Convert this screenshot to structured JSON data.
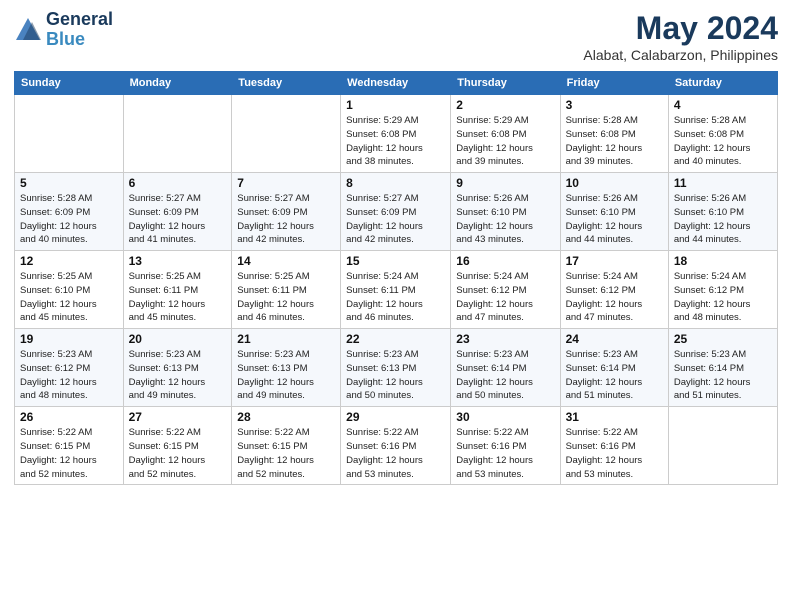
{
  "logo": {
    "line1": "General",
    "line2": "Blue"
  },
  "header": {
    "month_year": "May 2024",
    "location": "Alabat, Calabarzon, Philippines"
  },
  "days_of_week": [
    "Sunday",
    "Monday",
    "Tuesday",
    "Wednesday",
    "Thursday",
    "Friday",
    "Saturday"
  ],
  "weeks": [
    [
      {
        "day": "",
        "info": ""
      },
      {
        "day": "",
        "info": ""
      },
      {
        "day": "",
        "info": ""
      },
      {
        "day": "1",
        "info": "Sunrise: 5:29 AM\nSunset: 6:08 PM\nDaylight: 12 hours\nand 38 minutes."
      },
      {
        "day": "2",
        "info": "Sunrise: 5:29 AM\nSunset: 6:08 PM\nDaylight: 12 hours\nand 39 minutes."
      },
      {
        "day": "3",
        "info": "Sunrise: 5:28 AM\nSunset: 6:08 PM\nDaylight: 12 hours\nand 39 minutes."
      },
      {
        "day": "4",
        "info": "Sunrise: 5:28 AM\nSunset: 6:08 PM\nDaylight: 12 hours\nand 40 minutes."
      }
    ],
    [
      {
        "day": "5",
        "info": "Sunrise: 5:28 AM\nSunset: 6:09 PM\nDaylight: 12 hours\nand 40 minutes."
      },
      {
        "day": "6",
        "info": "Sunrise: 5:27 AM\nSunset: 6:09 PM\nDaylight: 12 hours\nand 41 minutes."
      },
      {
        "day": "7",
        "info": "Sunrise: 5:27 AM\nSunset: 6:09 PM\nDaylight: 12 hours\nand 42 minutes."
      },
      {
        "day": "8",
        "info": "Sunrise: 5:27 AM\nSunset: 6:09 PM\nDaylight: 12 hours\nand 42 minutes."
      },
      {
        "day": "9",
        "info": "Sunrise: 5:26 AM\nSunset: 6:10 PM\nDaylight: 12 hours\nand 43 minutes."
      },
      {
        "day": "10",
        "info": "Sunrise: 5:26 AM\nSunset: 6:10 PM\nDaylight: 12 hours\nand 44 minutes."
      },
      {
        "day": "11",
        "info": "Sunrise: 5:26 AM\nSunset: 6:10 PM\nDaylight: 12 hours\nand 44 minutes."
      }
    ],
    [
      {
        "day": "12",
        "info": "Sunrise: 5:25 AM\nSunset: 6:10 PM\nDaylight: 12 hours\nand 45 minutes."
      },
      {
        "day": "13",
        "info": "Sunrise: 5:25 AM\nSunset: 6:11 PM\nDaylight: 12 hours\nand 45 minutes."
      },
      {
        "day": "14",
        "info": "Sunrise: 5:25 AM\nSunset: 6:11 PM\nDaylight: 12 hours\nand 46 minutes."
      },
      {
        "day": "15",
        "info": "Sunrise: 5:24 AM\nSunset: 6:11 PM\nDaylight: 12 hours\nand 46 minutes."
      },
      {
        "day": "16",
        "info": "Sunrise: 5:24 AM\nSunset: 6:12 PM\nDaylight: 12 hours\nand 47 minutes."
      },
      {
        "day": "17",
        "info": "Sunrise: 5:24 AM\nSunset: 6:12 PM\nDaylight: 12 hours\nand 47 minutes."
      },
      {
        "day": "18",
        "info": "Sunrise: 5:24 AM\nSunset: 6:12 PM\nDaylight: 12 hours\nand 48 minutes."
      }
    ],
    [
      {
        "day": "19",
        "info": "Sunrise: 5:23 AM\nSunset: 6:12 PM\nDaylight: 12 hours\nand 48 minutes."
      },
      {
        "day": "20",
        "info": "Sunrise: 5:23 AM\nSunset: 6:13 PM\nDaylight: 12 hours\nand 49 minutes."
      },
      {
        "day": "21",
        "info": "Sunrise: 5:23 AM\nSunset: 6:13 PM\nDaylight: 12 hours\nand 49 minutes."
      },
      {
        "day": "22",
        "info": "Sunrise: 5:23 AM\nSunset: 6:13 PM\nDaylight: 12 hours\nand 50 minutes."
      },
      {
        "day": "23",
        "info": "Sunrise: 5:23 AM\nSunset: 6:14 PM\nDaylight: 12 hours\nand 50 minutes."
      },
      {
        "day": "24",
        "info": "Sunrise: 5:23 AM\nSunset: 6:14 PM\nDaylight: 12 hours\nand 51 minutes."
      },
      {
        "day": "25",
        "info": "Sunrise: 5:23 AM\nSunset: 6:14 PM\nDaylight: 12 hours\nand 51 minutes."
      }
    ],
    [
      {
        "day": "26",
        "info": "Sunrise: 5:22 AM\nSunset: 6:15 PM\nDaylight: 12 hours\nand 52 minutes."
      },
      {
        "day": "27",
        "info": "Sunrise: 5:22 AM\nSunset: 6:15 PM\nDaylight: 12 hours\nand 52 minutes."
      },
      {
        "day": "28",
        "info": "Sunrise: 5:22 AM\nSunset: 6:15 PM\nDaylight: 12 hours\nand 52 minutes."
      },
      {
        "day": "29",
        "info": "Sunrise: 5:22 AM\nSunset: 6:16 PM\nDaylight: 12 hours\nand 53 minutes."
      },
      {
        "day": "30",
        "info": "Sunrise: 5:22 AM\nSunset: 6:16 PM\nDaylight: 12 hours\nand 53 minutes."
      },
      {
        "day": "31",
        "info": "Sunrise: 5:22 AM\nSunset: 6:16 PM\nDaylight: 12 hours\nand 53 minutes."
      },
      {
        "day": "",
        "info": ""
      }
    ]
  ]
}
